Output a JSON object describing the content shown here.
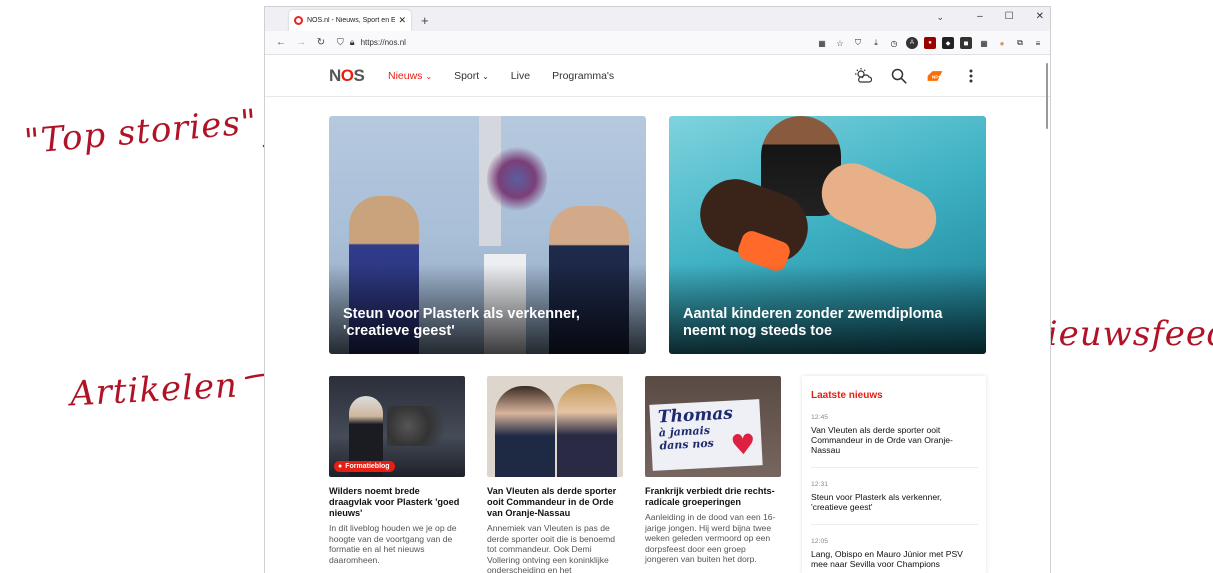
{
  "annotations": {
    "top_stories": "\"Top stories\"",
    "artikelen": "Artikelen",
    "nieuwsfeed": "Nieuwsfeed"
  },
  "browser": {
    "tab_title": "NOS.nl - Nieuws, Sport en Eve",
    "tab_close": "✕",
    "new_tab": "+",
    "url": "https://nos.nl",
    "window_controls": [
      "–",
      "☐",
      "✕"
    ]
  },
  "site": {
    "logo_text": [
      "N",
      "O",
      "S"
    ],
    "nav": [
      {
        "label": "Nieuws",
        "suffix": "⌄",
        "active": true
      },
      {
        "label": "Sport",
        "suffix": "⌄",
        "active": false
      },
      {
        "label": "Live",
        "suffix": "",
        "active": false
      },
      {
        "label": "Programma's",
        "suffix": "",
        "active": false
      }
    ],
    "icons": [
      "weather-icon",
      "search-icon",
      "npo-logo-icon",
      "more-vertical-icon"
    ],
    "accent": "#e61e14"
  },
  "top_stories": [
    {
      "headline": "Steun voor Plasterk als verkenner, 'creatieve geest'"
    },
    {
      "headline": "Aantal kinderen zonder zwemdiploma neemt nog steeds toe"
    }
  ],
  "articles": [
    {
      "badge": "Formatieblog",
      "title": "Wilders noemt brede draagvlak voor Plasterk 'goed nieuws'",
      "lead": "In dit liveblog houden we je op de hoogte van de voortgang van de formatie en al het nieuws daaromheen."
    },
    {
      "badge": "",
      "title": "Van Vleuten als derde sporter ooit Commandeur in de Orde van Oranje-Nassau",
      "lead": "Annemiek van Vleuten is pas de derde sporter ooit die is benoemd tot commandeur. Ook Demi Vollering ontving een koninklijke onderscheiding en het"
    },
    {
      "badge": "",
      "title": "Frankrijk verbiedt drie rechts-radicale groeperingen",
      "lead": "Aanleiding in de dood van een 16-jarige jongen. Hij werd bijna twee weken geleden vermoord op een dorpsfeest door een groep jongeren van buiten het dorp.",
      "banner_text": [
        "Thomas",
        "à jamais",
        "dans nos"
      ]
    }
  ],
  "feed": {
    "title": "Laatste nieuws",
    "items": [
      {
        "time": "12:45",
        "text": "Van Vleuten als derde sporter ooit Commandeur in de Orde van Oranje-Nassau"
      },
      {
        "time": "12:31",
        "text": "Steun voor Plasterk als verkenner, 'creatieve geest'"
      },
      {
        "time": "12:05",
        "text": "Lang, Obispo en Mauro Júnior met PSV mee naar Sevilla voor Champions"
      }
    ]
  }
}
